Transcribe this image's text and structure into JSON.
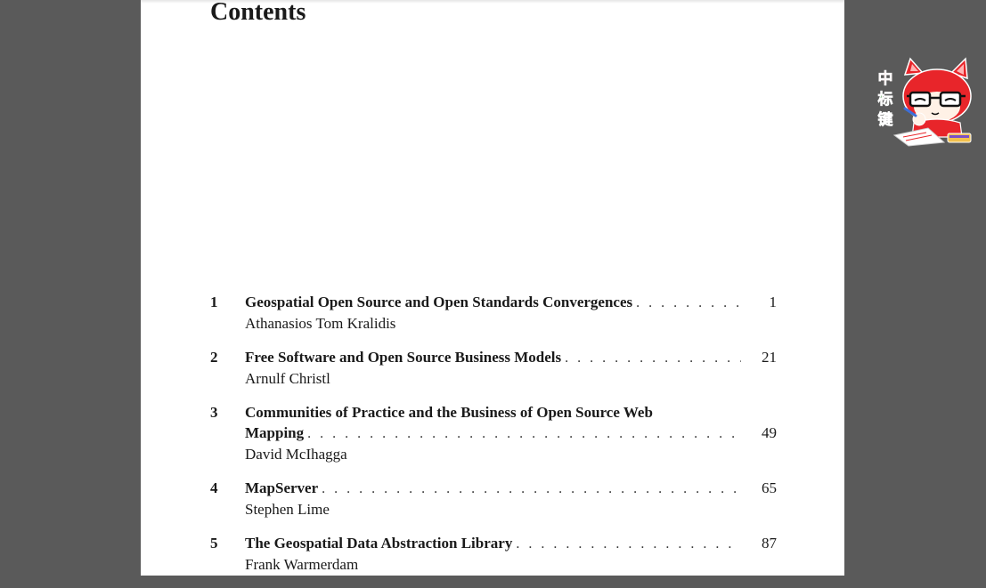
{
  "document": {
    "heading": "Contents",
    "entries": [
      {
        "number": "1",
        "title": "Geospatial Open Source and Open Standards Convergences",
        "title_first": "",
        "page": "1",
        "author": "Athanasios Tom Kralidis"
      },
      {
        "number": "2",
        "title": "Free Software and Open Source Business Models",
        "title_first": "",
        "page": "21",
        "author": "Arnulf Christl"
      },
      {
        "number": "3",
        "title_first": "Communities of Practice and the Business of Open Source Web",
        "title": "Mapping",
        "page": "49",
        "author": "David McIhagga"
      },
      {
        "number": "4",
        "title": "MapServer",
        "title_first": "",
        "page": "65",
        "author": "Stephen Lime"
      },
      {
        "number": "5",
        "title": "The Geospatial Data Abstraction Library",
        "title_first": "",
        "page": "87",
        "author": "Frank Warmerdam"
      }
    ]
  },
  "mascot": {
    "chars": [
      "中",
      "标",
      "键"
    ],
    "colors": {
      "fur": "#e8252a",
      "char1": "#e23a2f",
      "char2": "#3f8f3a",
      "char3": "#3f8f3a"
    }
  }
}
